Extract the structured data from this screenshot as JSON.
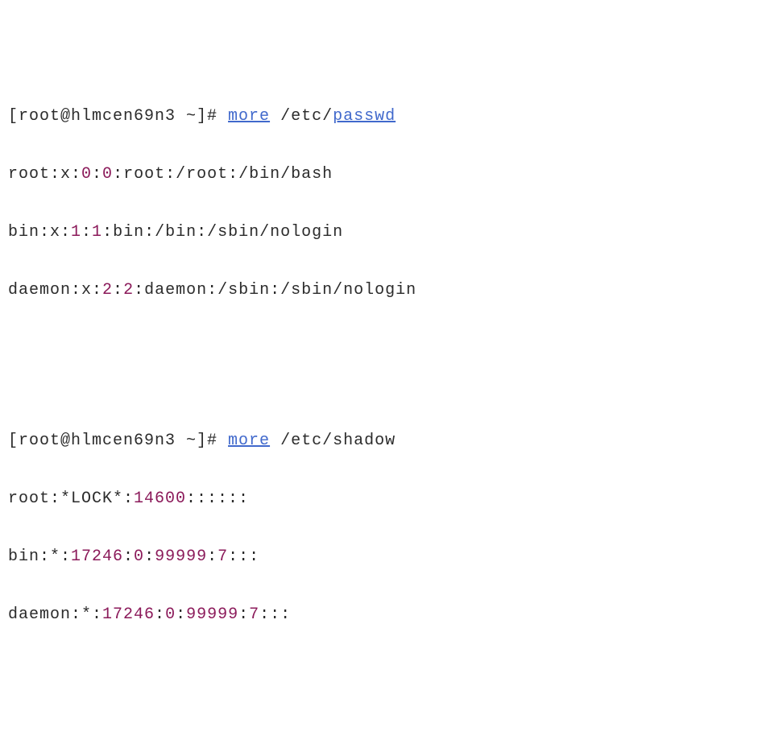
{
  "lines": [
    {
      "type": "prompt",
      "prefix": "[root@hlmcen69n3 ~]# ",
      "cmd": "more",
      "path_prefix": " /etc/",
      "path_file": "passwd"
    },
    {
      "type": "passwd-entry",
      "user": "root",
      "x": "x",
      "uid": "0",
      "gid": "0",
      "gecos": "root",
      "home": "/root",
      "shell": "/bin/bash"
    },
    {
      "type": "passwd-entry",
      "user": "bin",
      "x": "x",
      "uid": "1",
      "gid": "1",
      "gecos": "bin",
      "home": "/bin",
      "shell": "/sbin/nologin"
    },
    {
      "type": "passwd-entry",
      "user": "daemon",
      "x": "x",
      "uid": "2",
      "gid": "2",
      "gecos": "daemon",
      "home": "/sbin",
      "shell": "/sbin/nologin"
    },
    {
      "type": "gap"
    },
    {
      "type": "prompt",
      "prefix": "[root@hlmcen69n3 ~]# ",
      "cmd": "more",
      "path_prefix": " /etc/shadow",
      "path_file": ""
    },
    {
      "type": "shadow-entry",
      "user": "root",
      "pw": "*LOCK*",
      "lastchg": "14600",
      "rest": "::::::"
    },
    {
      "type": "shadow-entry",
      "user": "bin",
      "pw": "*",
      "lastchg": "17246",
      "min": "0",
      "max": "99999",
      "warn": "7",
      "rest": ":::"
    },
    {
      "type": "shadow-entry",
      "user": "daemon",
      "pw": "*",
      "lastchg": "17246",
      "min": "0",
      "max": "99999",
      "warn": "7",
      "rest": ":::"
    }
  ]
}
